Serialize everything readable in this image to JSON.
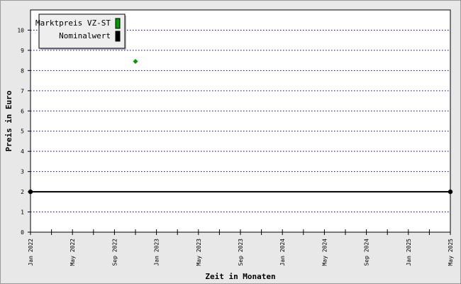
{
  "chart_data": {
    "type": "line",
    "xlabel": "Zeit in Monaten",
    "ylabel": "Preis in Euro",
    "ylim": [
      0,
      11
    ],
    "yticks": [
      0,
      1,
      2,
      3,
      4,
      5,
      6,
      7,
      8,
      9,
      10
    ],
    "xlim": [
      "2022-01",
      "2025-05"
    ],
    "xtick_labels": [
      {
        "label": "Jan 2022",
        "date": "2022-01"
      },
      {
        "label": "May 2022",
        "date": "2022-05"
      },
      {
        "label": "Sep 2022",
        "date": "2022-09"
      },
      {
        "label": "Jan 2023",
        "date": "2023-01"
      },
      {
        "label": "May 2023",
        "date": "2023-05"
      },
      {
        "label": "Sep 2023",
        "date": "2023-09"
      },
      {
        "label": "Jan 2024",
        "date": "2024-01"
      },
      {
        "label": "May 2024",
        "date": "2024-05"
      },
      {
        "label": "Sep 2024",
        "date": "2024-09"
      },
      {
        "label": "Jan 2025",
        "date": "2025-01"
      },
      {
        "label": "May 2025",
        "date": "2025-05"
      }
    ],
    "minor_tick_step_months": 2,
    "grid": "horizontal dotted",
    "legend_position": "top-left",
    "series": [
      {
        "name": "Marktpreis VZ-ST",
        "color": "#009900",
        "marker": "diamond",
        "points": [
          {
            "x": "2022-11",
            "y": 8.45
          }
        ]
      },
      {
        "name": "Nominalwert",
        "color": "#000000",
        "marker": "circle",
        "points": [
          {
            "x": "2022-01",
            "y": 2
          },
          {
            "x": "2025-05",
            "y": 2
          }
        ]
      }
    ]
  }
}
